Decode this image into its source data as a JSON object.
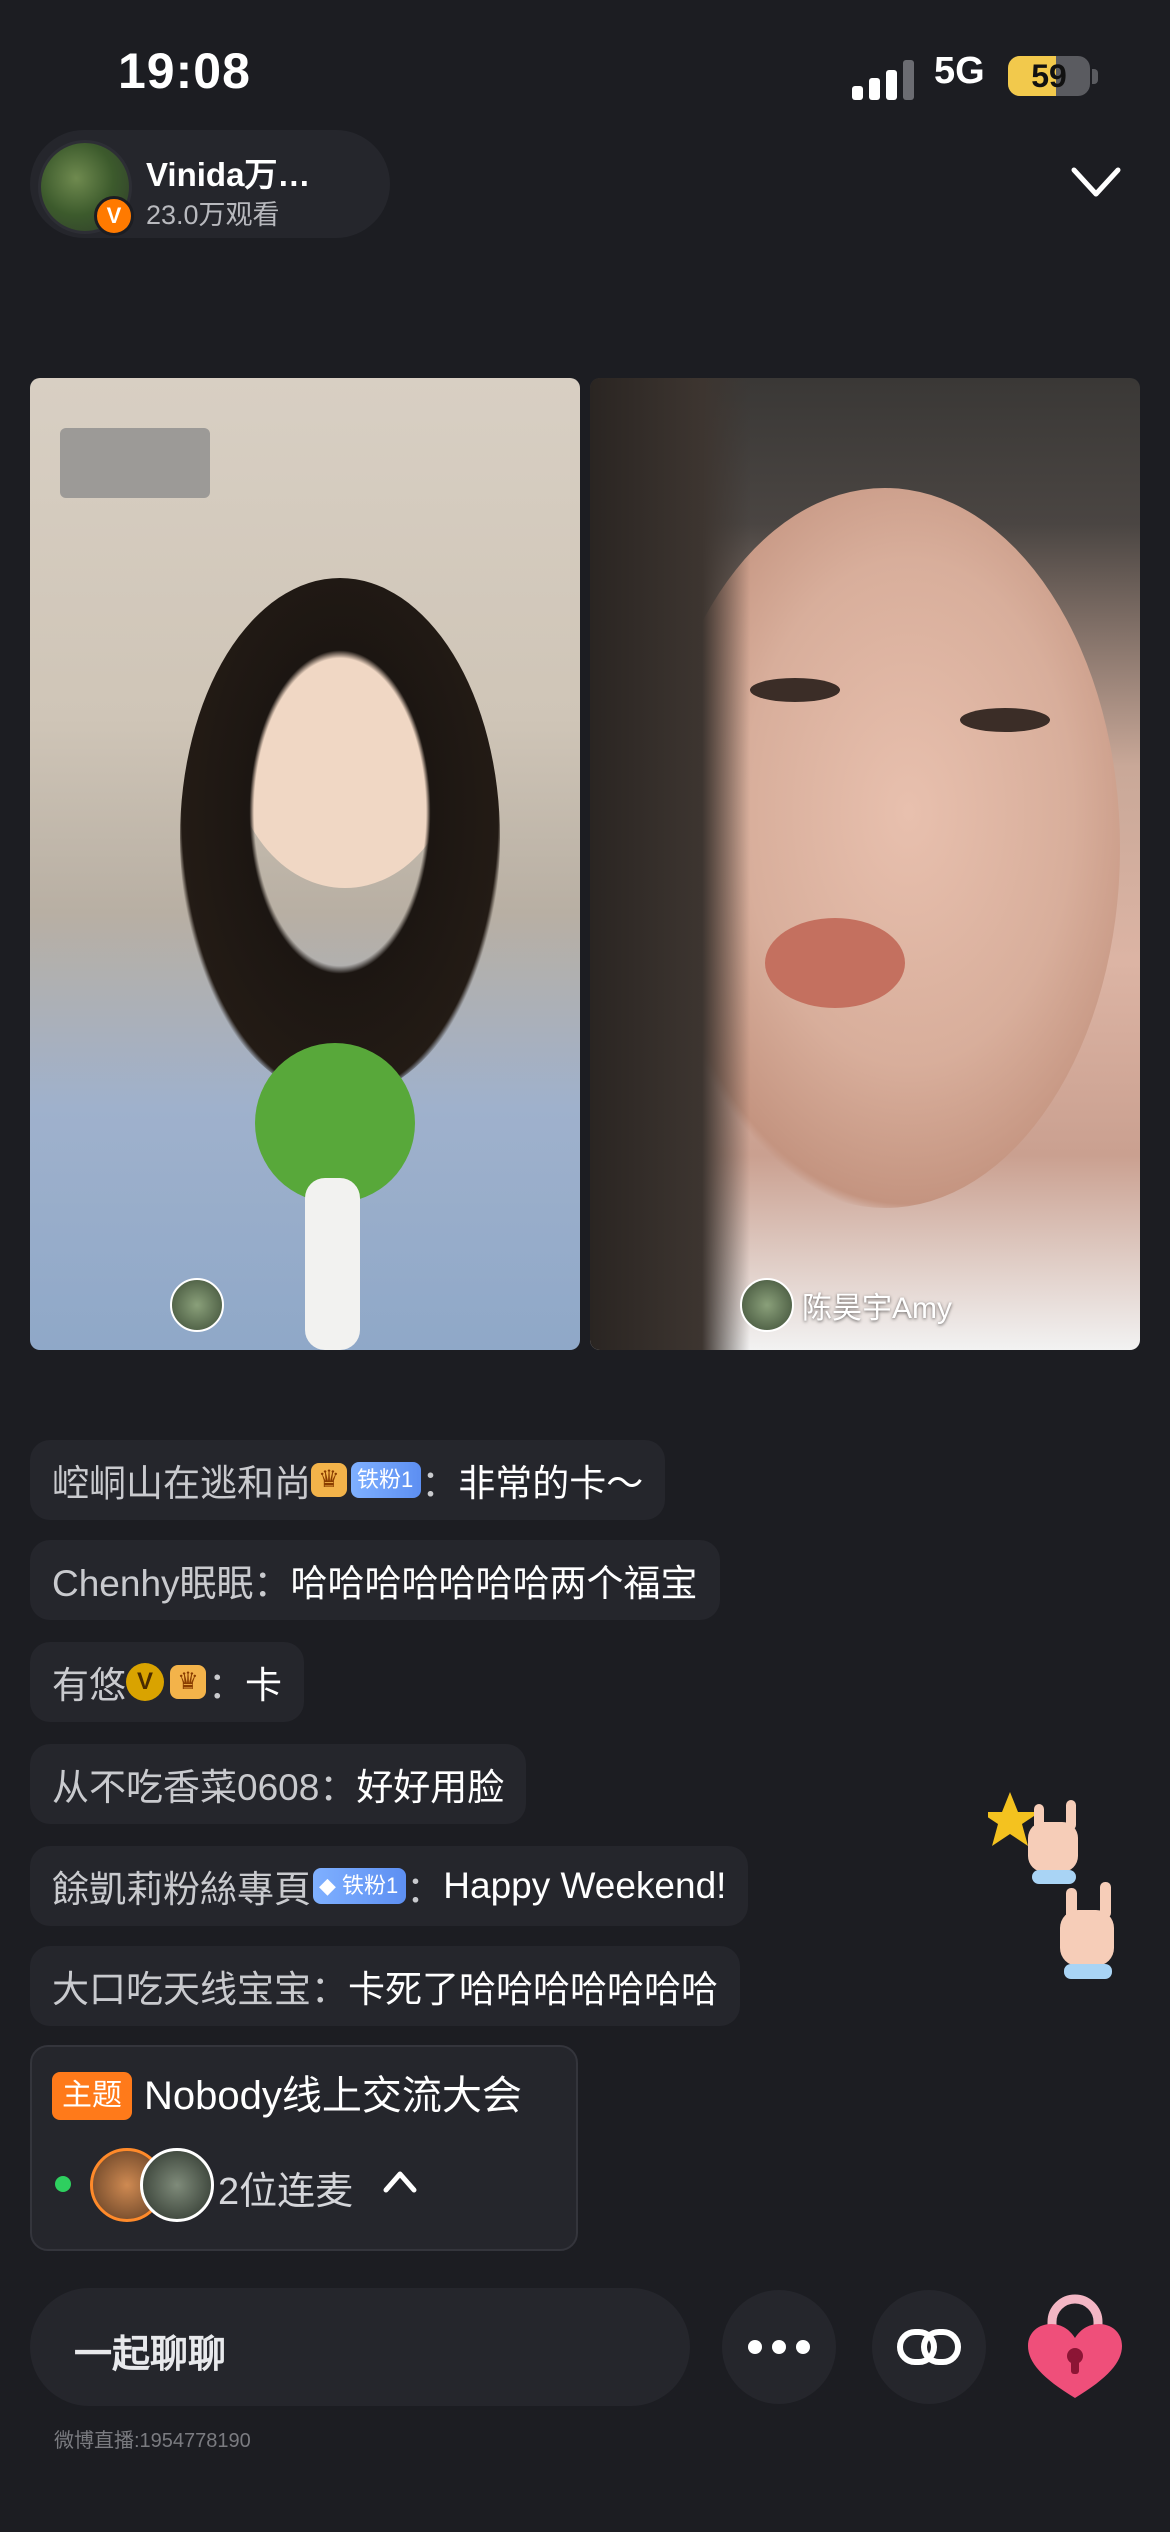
{
  "status_bar": {
    "time": "19:08",
    "network": "5G",
    "battery": "59",
    "battery_level": 0.59
  },
  "host": {
    "name": "Vinida万…",
    "viewers": "23.0万观看",
    "badge": "V"
  },
  "tiles": {
    "left_caption": "",
    "right_caption": "陈昊宇Amy"
  },
  "comments": [
    {
      "user": "崆峒山在逃和尚",
      "badges": [
        "crown",
        "fan"
      ],
      "fan_label": "铁粉1",
      "sep": "：",
      "message": "非常的卡～"
    },
    {
      "user": "Chenhy眠眠",
      "badges": [],
      "sep": "：",
      "message": "哈哈哈哈哈哈哈两个福宝"
    },
    {
      "user": "有悠",
      "badges": [
        "v",
        "crown"
      ],
      "sep": "：",
      "message": "卡"
    },
    {
      "user": "从不吃香菜0608",
      "badges": [],
      "sep": "：",
      "message": "好好用脸"
    },
    {
      "user": "餘凱莉粉絲專頁",
      "badges": [
        "diamond-fan"
      ],
      "fan_label": "铁粉1",
      "sep": "：",
      "message": "Happy Weekend!"
    },
    {
      "user": "大口吃天线宝宝",
      "badges": [],
      "sep": "：",
      "message": "卡死了哈哈哈哈哈哈哈"
    }
  ],
  "topic": {
    "tag": "主题",
    "title": "Nobody线上交流大会",
    "mic_count": "2位连麦"
  },
  "bottom": {
    "chat_placeholder": "一起聊聊",
    "footer_id": "微博直播:1954778190"
  },
  "icons": {
    "collapse": "chevron-down-icon",
    "expand": "chevron-up-icon",
    "more": "more-dots-icon",
    "link": "link-icon",
    "lock": "heart-lock-icon"
  },
  "colors": {
    "background": "#1c1d22",
    "pill": "#25262c",
    "accent_orange": "#ff7a1a",
    "live_green": "#2ecf5f"
  }
}
